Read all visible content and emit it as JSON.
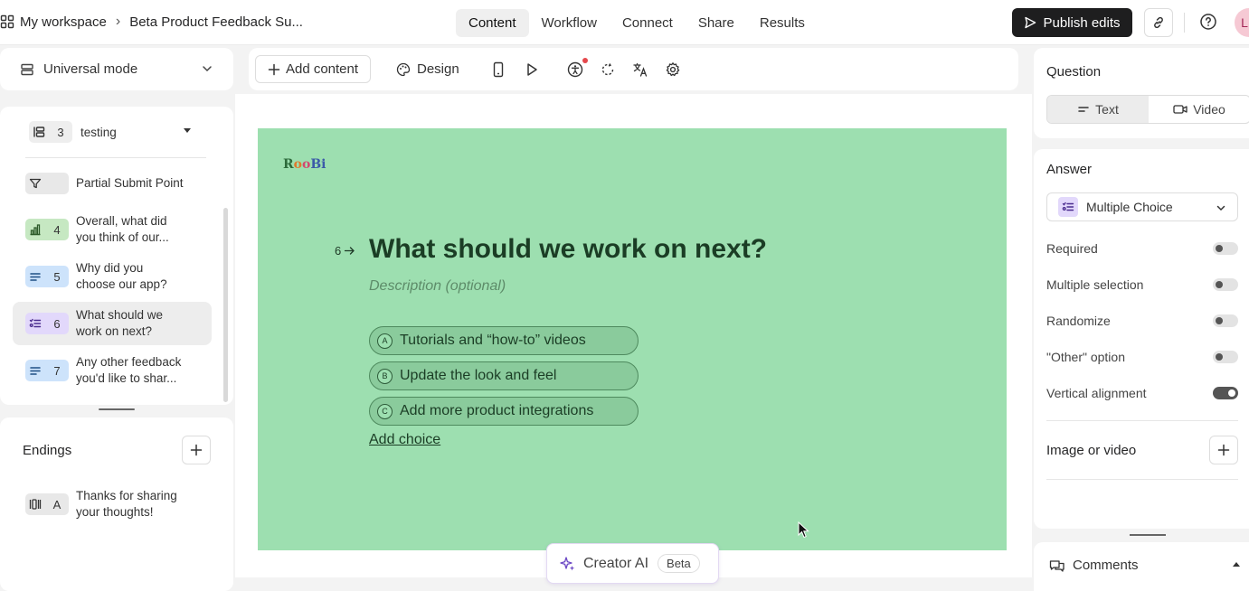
{
  "header": {
    "workspace": "My workspace",
    "form_title": "Beta Product Feedback Su...",
    "tabs": [
      {
        "label": "Content",
        "active": true
      },
      {
        "label": "Workflow",
        "active": false
      },
      {
        "label": "Connect",
        "active": false
      },
      {
        "label": "Share",
        "active": false
      },
      {
        "label": "Results",
        "active": false
      }
    ],
    "publish_label": "Publish edits",
    "avatar_initial": "L"
  },
  "sidebar": {
    "mode": "Universal mode",
    "group": {
      "count": "3",
      "name": "testing"
    },
    "items": [
      {
        "num": "",
        "label": "Partial Submit Point",
        "type": "filter-icon",
        "color": "#e8e8e8"
      },
      {
        "num": "4",
        "label": "Overall, what did you think of our...",
        "type": "bar-chart-icon",
        "color": "#c6e8c2"
      },
      {
        "num": "5",
        "label": "Why did you choose our app?",
        "type": "text-lines-icon",
        "color": "#cde3fb"
      },
      {
        "num": "6",
        "label": "What should we work on next?",
        "type": "list-choice-icon",
        "color": "#e2d8fb"
      },
      {
        "num": "7",
        "label": "Any other feedback you'd like to shar...",
        "type": "text-lines-icon",
        "color": "#cde3fb"
      }
    ],
    "endings_title": "Endings",
    "ending": {
      "key": "A",
      "label": "Thanks for sharing your thoughts!"
    }
  },
  "toolbar": {
    "add_content": "Add content",
    "design": "Design"
  },
  "canvas": {
    "bg_color": "#9ddfb0",
    "logo": "RooBi",
    "question_number": "6",
    "question_title": "What should we work on next?",
    "description_placeholder": "Description (optional)",
    "choices": [
      {
        "key": "A",
        "label": "Tutorials and “how-to” videos"
      },
      {
        "key": "B",
        "label": "Update the look and feel"
      },
      {
        "key": "C",
        "label": "Add more product integrations"
      }
    ],
    "add_choice": "Add choice"
  },
  "creator_ai": {
    "label": "Creator AI",
    "badge": "Beta"
  },
  "right_panel": {
    "question_title": "Question",
    "seg": {
      "text": "Text",
      "video": "Video"
    },
    "answer_title": "Answer",
    "answer_type": "Multiple Choice",
    "options": [
      {
        "label": "Required",
        "on": false
      },
      {
        "label": "Multiple selection",
        "on": false
      },
      {
        "label": "Randomize",
        "on": false
      },
      {
        "label": "\"Other\" option",
        "on": false
      },
      {
        "label": "Vertical alignment",
        "on": true
      }
    ],
    "image_or_video": "Image or video",
    "comments": "Comments"
  }
}
